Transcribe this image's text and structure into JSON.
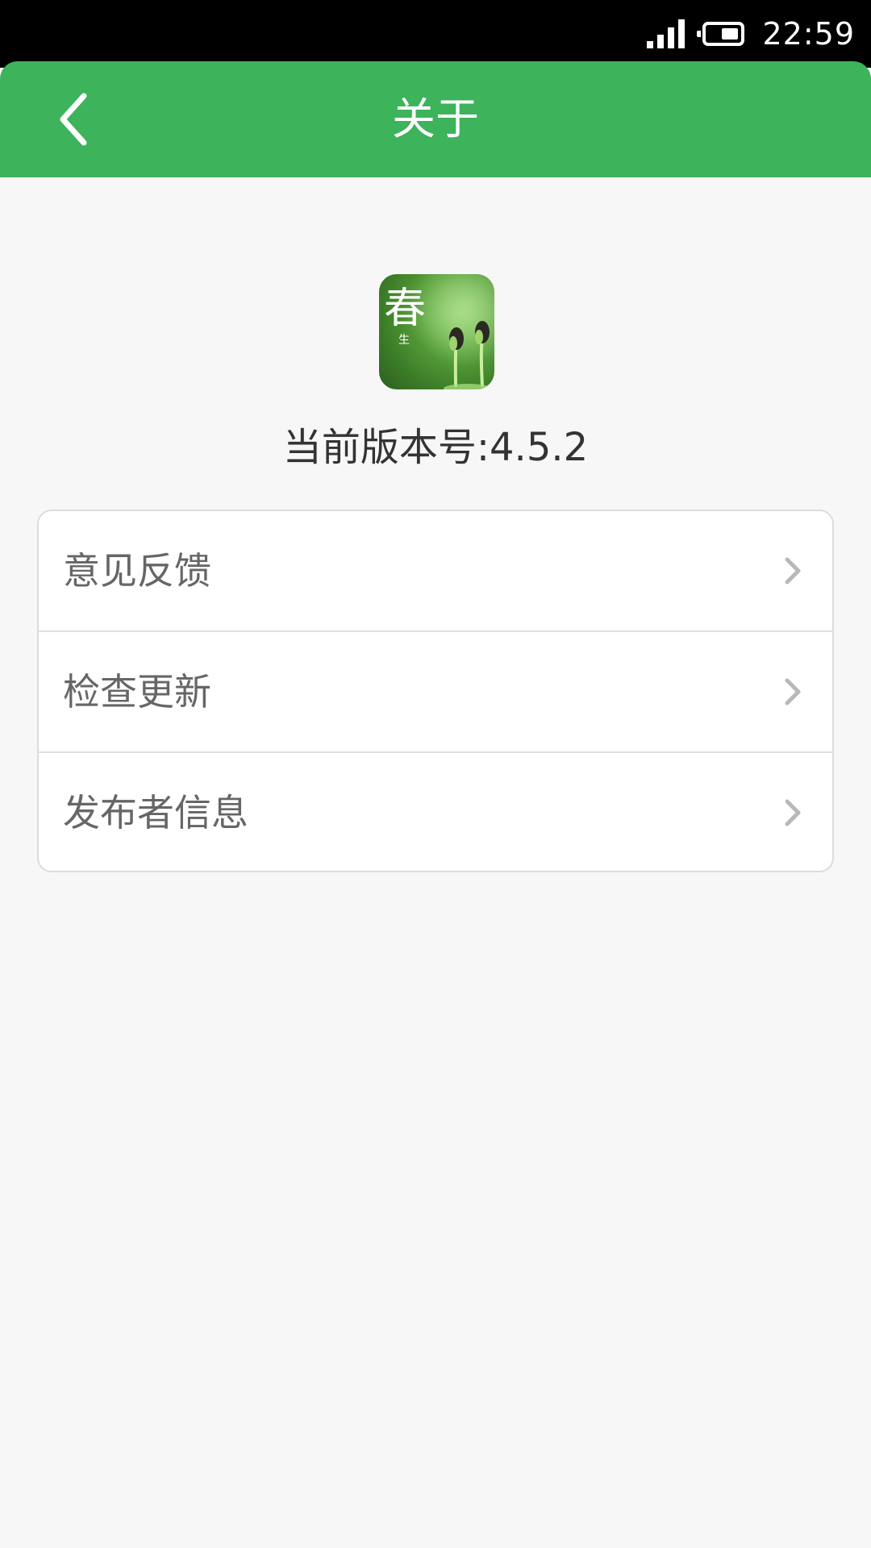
{
  "status_bar": {
    "time": "22:59",
    "icons": [
      "signal-icon",
      "battery-icon"
    ]
  },
  "header": {
    "title": "关于",
    "back_icon": "chevron-left-icon"
  },
  "app": {
    "logo_text": "春",
    "logo_subtext": "生",
    "version_text": "当前版本号:4.5.2"
  },
  "menu": {
    "items": [
      {
        "label": "意见反馈"
      },
      {
        "label": "检查更新"
      },
      {
        "label": "发布者信息"
      }
    ]
  },
  "colors": {
    "accent": "#3db35b",
    "background": "#f7f7f7",
    "card": "#ffffff",
    "text_primary": "#333333",
    "text_secondary": "#666666",
    "chevron": "#b8b8b8"
  }
}
